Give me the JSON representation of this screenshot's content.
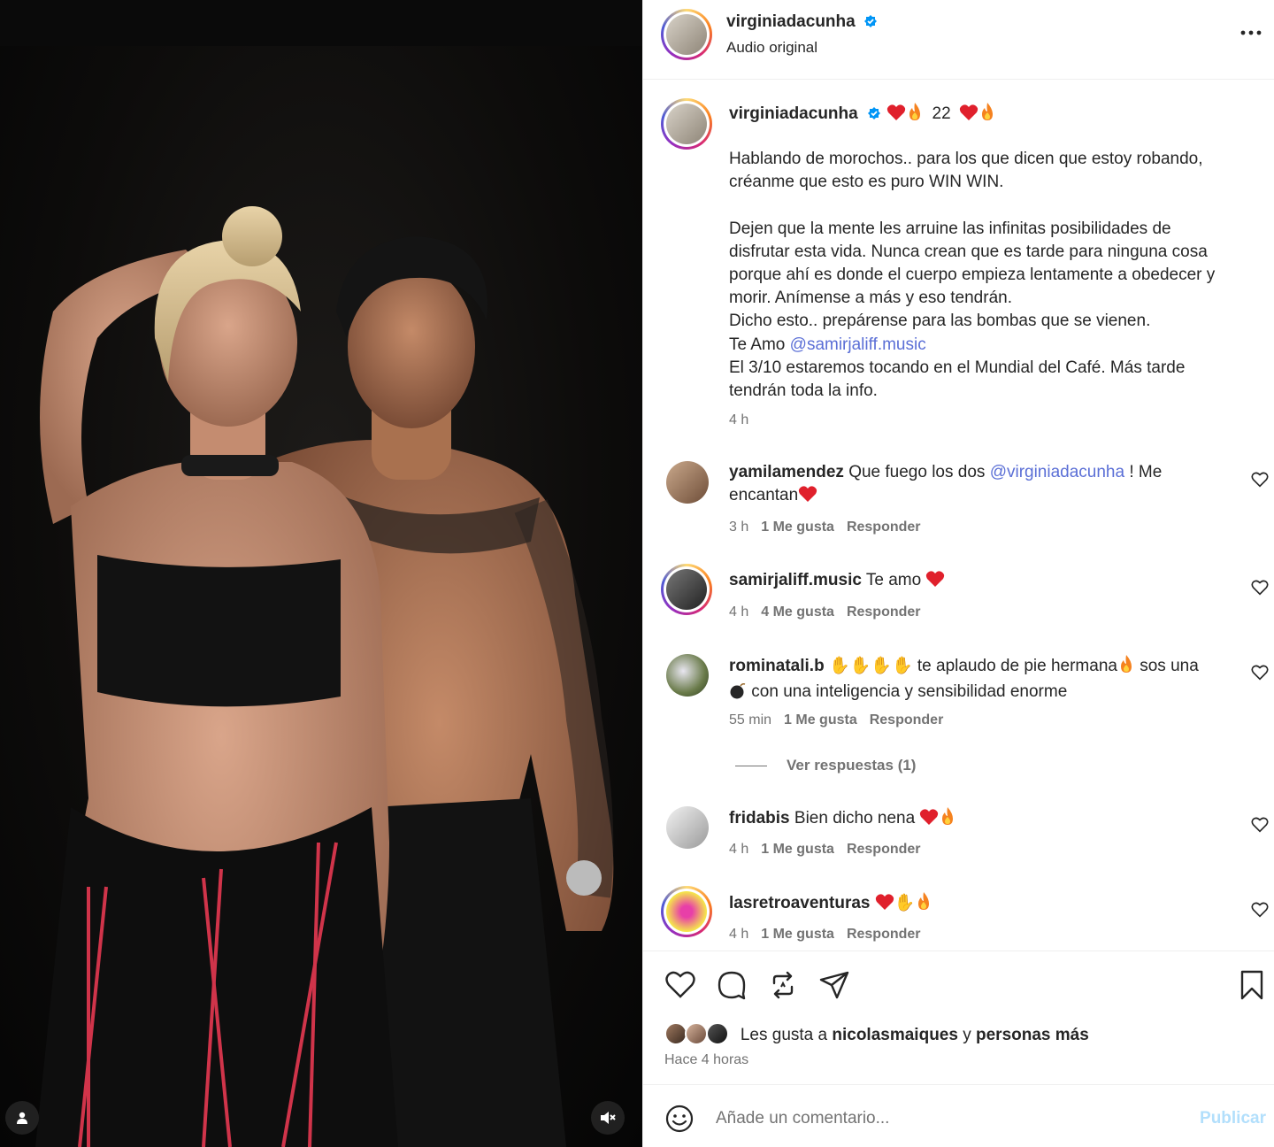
{
  "post": {
    "username": "virginiadacunha",
    "audio": "Audio original",
    "caption_suffix": "22",
    "caption": "Hablando de morochos.. para los que dicen que estoy robando,\ncréanme que esto es puro WIN WIN.\n\nDejen que la mente les arruine las infinitas posibilidades de\ndisfrutar esta vida. Nunca crean que es tarde para ninguna cosa\nporque ahí es donde el cuerpo empieza lentamente a obedecer y\nmorir. Anímense a más y eso tendrán.\nDicho esto.. prepárense para las bombas que se vienen.",
    "caption_love": "Te Amo ",
    "caption_mention": "@samirjaliff.music",
    "caption_end": "El 3/10 estaremos tocando en el Mundial del Café. Más tarde\ntendrán toda la info.",
    "caption_time": "4 h"
  },
  "comments": [
    {
      "user": "yamilamendez",
      "text_a": "Que fuego los dos ",
      "mention": "@virginiadacunha",
      "text_b": " ! Me",
      "text_c": "encantan",
      "time": "3 h",
      "likes": "1 Me gusta",
      "reply": "Responder"
    },
    {
      "user": "samirjaliff.music",
      "text_a": "Te amo",
      "time": "4 h",
      "likes": "4 Me gusta",
      "reply": "Responder"
    },
    {
      "user": "rominatali.b",
      "text_a": " te aplaudo de pie hermana",
      "text_b": " sos una",
      "text_c": " con una inteligencia y sensibilidad enorme",
      "time": "55 min",
      "likes": "1 Me gusta",
      "reply": "Responder",
      "view_replies": "Ver respuestas (1)"
    },
    {
      "user": "fridabis",
      "text_a": "Bien dicho nena",
      "time": "4 h",
      "likes": "1 Me gusta",
      "reply": "Responder"
    },
    {
      "user": "lasretroaventuras",
      "text_a": "",
      "time": "4 h",
      "likes": "1 Me gusta",
      "reply": "Responder"
    }
  ],
  "footer": {
    "likes_prefix": "Les gusta a ",
    "likes_user": "nicolasmaiques",
    "likes_mid": " y ",
    "likes_rest": "personas más",
    "posted": "Hace 4 horas",
    "placeholder": "Añade un comentario...",
    "publish": "Publicar"
  },
  "icons": {
    "verified": "verified-badge-icon",
    "more": "more-options-icon",
    "like": "heart-icon",
    "comment": "comment-icon",
    "repost": "repost-icon",
    "share": "share-icon",
    "save": "bookmark-icon",
    "emoji": "emoji-icon",
    "mute": "muted-speaker-icon",
    "tag": "user-tag-icon"
  },
  "colors": {
    "link": "#5b6fd6",
    "verified": "#0095f6",
    "publish_disabled": "#b2dffc",
    "muted_text": "#737373"
  }
}
